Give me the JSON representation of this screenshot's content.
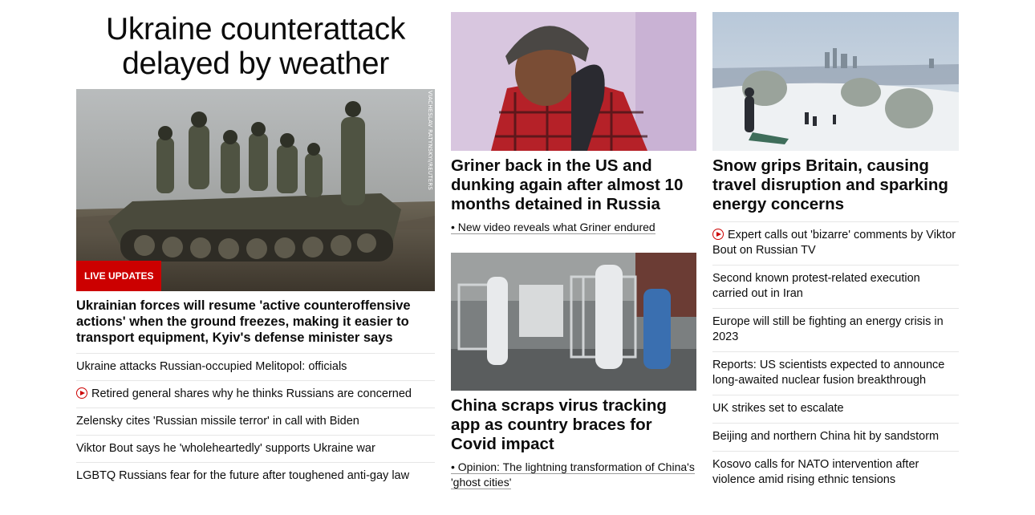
{
  "left": {
    "headline": "Ukraine counterattack delayed by weather",
    "photo_credit": "VIACHESLAV RATYNSKYI/REUTERS",
    "live_badge": "LIVE UPDATES",
    "lead": "Ukrainian forces will resume 'active counteroffensive actions' when the ground freezes, making it easier to transport equipment, Kyiv's defense minister says",
    "items": [
      {
        "text": "Ukraine attacks Russian-occupied Melitopol: officials",
        "video": false
      },
      {
        "text": "Retired general shares why he thinks Russians are concerned",
        "video": true
      },
      {
        "text": "Zelensky cites 'Russian missile terror' in call with Biden",
        "video": false
      },
      {
        "text": "Viktor Bout says he 'wholeheartedly' supports Ukraine war",
        "video": false
      },
      {
        "text": "LGBTQ Russians fear for the future after toughened anti-gay law",
        "video": false
      }
    ]
  },
  "middle": {
    "story1": {
      "headline": "Griner back in the US and dunking again after almost 10 months detained in Russia",
      "sub": "• New video reveals what Griner endured"
    },
    "story2": {
      "headline": "China scraps virus tracking app as country braces for Covid impact",
      "sub": "• Opinion: The lightning transformation of China's 'ghost cities'"
    }
  },
  "right": {
    "headline": "Snow grips Britain, causing travel disruption and sparking energy concerns",
    "items": [
      {
        "text": "Expert calls out 'bizarre' comments by Viktor Bout on Russian TV",
        "video": true
      },
      {
        "text": "Second known protest-related execution carried out in Iran",
        "video": false
      },
      {
        "text": "Europe will still be fighting an energy crisis in 2023",
        "video": false
      },
      {
        "text": "Reports: US scientists expected to announce long-awaited nuclear fusion breakthrough",
        "video": false
      },
      {
        "text": "UK strikes set to escalate",
        "video": false
      },
      {
        "text": "Beijing and northern China hit by sandstorm",
        "video": false
      },
      {
        "text": "Kosovo calls for NATO intervention after violence amid rising ethnic tensions",
        "video": false
      }
    ]
  },
  "colors": {
    "accent": "#cc0000",
    "text": "#0c0c0c",
    "divider": "#e6e6e6"
  }
}
